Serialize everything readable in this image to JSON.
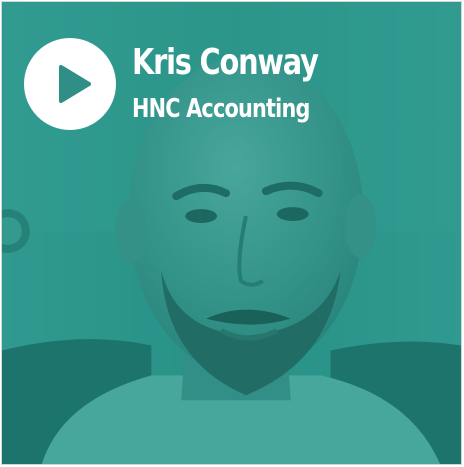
{
  "video": {
    "speaker_name": "Kris Conway",
    "course": "HNC Accounting",
    "play_icon": "play-icon",
    "overlay_color": "#1e8c80",
    "play_button_color": "#ffffff",
    "play_glyph_color": "#2f8f86"
  }
}
